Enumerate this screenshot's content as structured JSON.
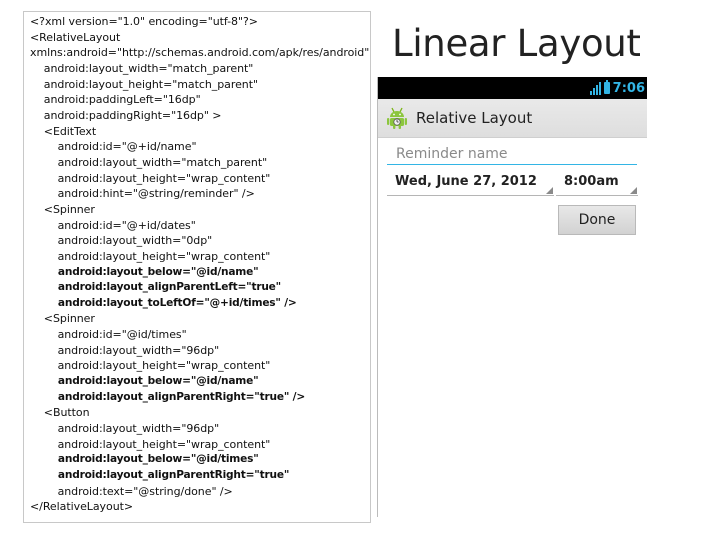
{
  "slide": {
    "title": "Linear Layout"
  },
  "code_lines": [
    "<?xml version=\"1.0\" encoding=\"utf-8\"?>",
    "<RelativeLayout",
    "xmlns:android=\"http://schemas.android.com/apk/res/android\"",
    "    android:layout_width=\"match_parent\"",
    "    android:layout_height=\"match_parent\"",
    "    android:paddingLeft=\"16dp\"",
    "    android:paddingRight=\"16dp\" >",
    "    <EditText",
    "        android:id=\"@+id/name\"",
    "        android:layout_width=\"match_parent\"",
    "        android:layout_height=\"wrap_content\"",
    "        android:hint=\"@string/reminder\" />",
    "    <Spinner",
    "        android:id=\"@+id/dates\"",
    "        android:layout_width=\"0dp\"",
    "        android:layout_height=\"wrap_content\"",
    "        android:layout_below=\"@id/name\"",
    "        android:layout_alignParentLeft=\"true\"",
    "        android:layout_toLeftOf=\"@+id/times\" />",
    "    <Spinner",
    "        android:id=\"@id/times\"",
    "        android:layout_width=\"96dp\"",
    "        android:layout_height=\"wrap_content\"",
    "        android:layout_below=\"@id/name\"",
    "        android:layout_alignParentRight=\"true\" />",
    "    <Button",
    "        android:layout_width=\"96dp\"",
    "        android:layout_height=\"wrap_content\"",
    "        android:layout_below=\"@id/times\"",
    "        android:layout_alignParentRight=\"true\"",
    "        android:text=\"@string/done\" />",
    "</RelativeLayout>"
  ],
  "bold_lines": [
    16,
    17,
    18,
    23,
    24,
    28,
    29
  ],
  "phone": {
    "status_bar": {
      "time": "7:06",
      "accent_color": "#33b5e5"
    },
    "action_bar": {
      "title": "Relative Layout",
      "icon": "android-robot-icon"
    },
    "reminder_field": {
      "placeholder": "Reminder name",
      "value": ""
    },
    "date_spinner": {
      "value": "Wed, June 27, 2012"
    },
    "time_spinner": {
      "value": "8:00am"
    },
    "done_button": {
      "label": "Done"
    }
  }
}
